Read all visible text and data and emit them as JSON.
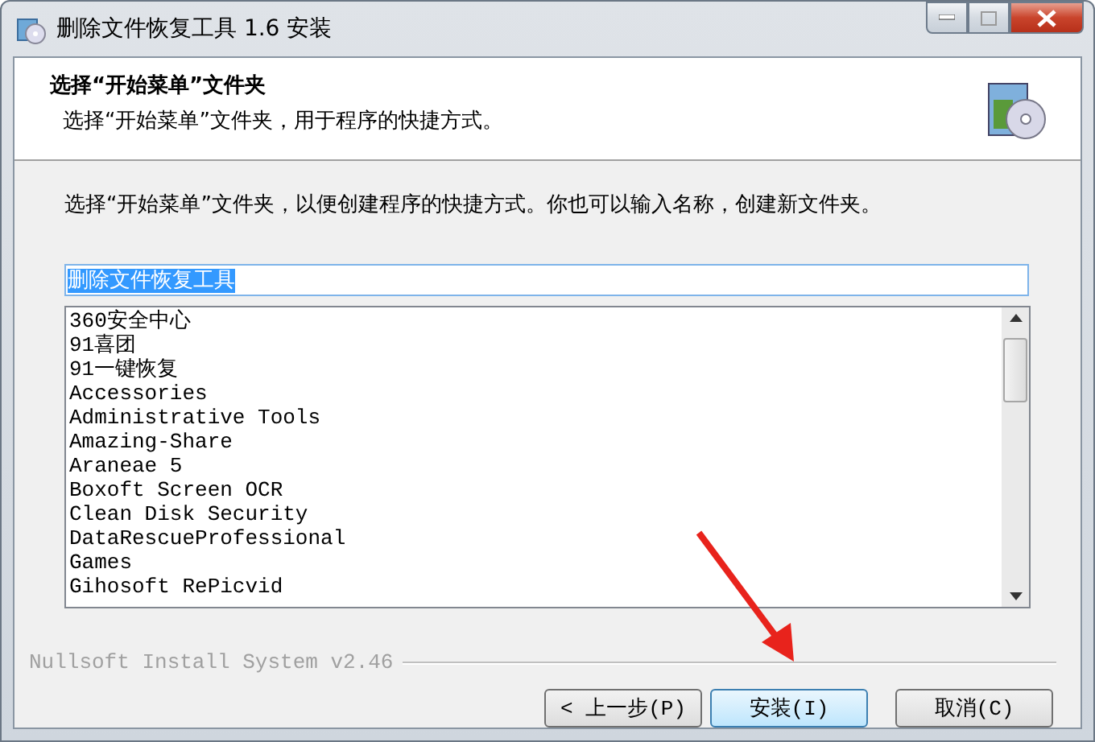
{
  "window": {
    "title": "删除文件恢复工具 1.6 安装"
  },
  "header": {
    "title": "选择“开始菜单”文件夹",
    "subtitle": "选择“开始菜单”文件夹，用于程序的快捷方式。"
  },
  "instruction": "选择“开始菜单”文件夹，以便创建程序的快捷方式。你也可以输入名称，创建新文件夹。",
  "folder_field": {
    "value": "删除文件恢复工具"
  },
  "folders": [
    "360安全中心",
    "91喜团",
    "91一键恢复",
    "Accessories",
    "Administrative Tools",
    "Amazing-Share",
    "Araneae 5",
    "Boxoft Screen OCR",
    "Clean Disk Security",
    "DataRescueProfessional",
    "Games",
    "Gihosoft RePicvid"
  ],
  "branding": "Nullsoft Install System v2.46",
  "buttons": [
    {
      "label": "< 上一步(P)",
      "selected": false
    },
    {
      "label": "安装(I)",
      "selected": true
    },
    {
      "label": "取消(C)",
      "selected": false
    }
  ]
}
